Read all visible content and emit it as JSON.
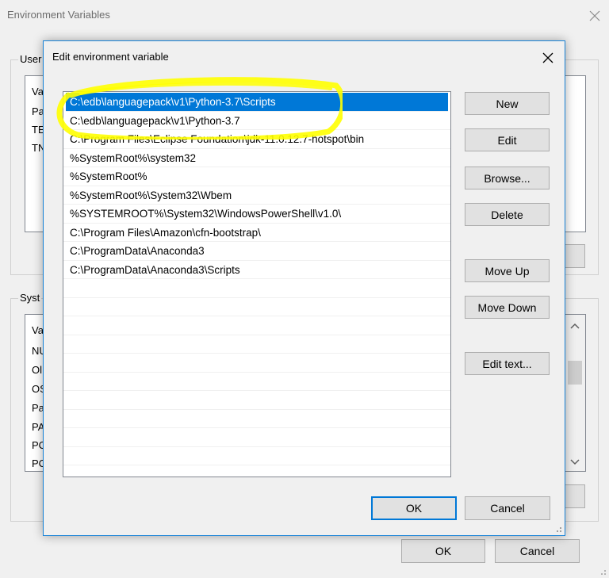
{
  "outer": {
    "title": "Environment Variables",
    "user_group_label": "User",
    "system_group_label": "Syst",
    "user_list": [
      "Va",
      "Pa",
      "TE",
      "TN"
    ],
    "system_list": [
      "Va",
      "NU",
      "Ol",
      "OS",
      "Pa",
      "PA",
      "PC",
      "PC"
    ],
    "ok_label": "OK",
    "cancel_label": "Cancel"
  },
  "inner": {
    "title": "Edit environment variable",
    "paths": [
      "C:\\edb\\languagepack\\v1\\Python-3.7\\Scripts",
      "C:\\edb\\languagepack\\v1\\Python-3.7",
      "C:\\Program Files\\Eclipse Foundation\\jdk-11.0.12.7-hotspot\\bin",
      "%SystemRoot%\\system32",
      "%SystemRoot%",
      "%SystemRoot%\\System32\\Wbem",
      "%SYSTEMROOT%\\System32\\WindowsPowerShell\\v1.0\\",
      "C:\\Program Files\\Amazon\\cfn-bootstrap\\",
      "C:\\ProgramData\\Anaconda3",
      "C:\\ProgramData\\Anaconda3\\Scripts"
    ],
    "selected_index": 0,
    "buttons": {
      "new": "New",
      "edit": "Edit",
      "browse": "Browse...",
      "delete": "Delete",
      "move_up": "Move Up",
      "move_down": "Move Down",
      "edit_text": "Edit text...",
      "ok": "OK",
      "cancel": "Cancel"
    }
  },
  "annotation": {
    "color": "#ffff00"
  },
  "icons": {
    "close": "close-icon",
    "scroll_up": "chevron-up-icon",
    "scroll_down": "chevron-down-icon",
    "resize": "resize-grip-icon"
  },
  "colors": {
    "selection": "#0078d7",
    "accent_border": "#1883d7"
  }
}
